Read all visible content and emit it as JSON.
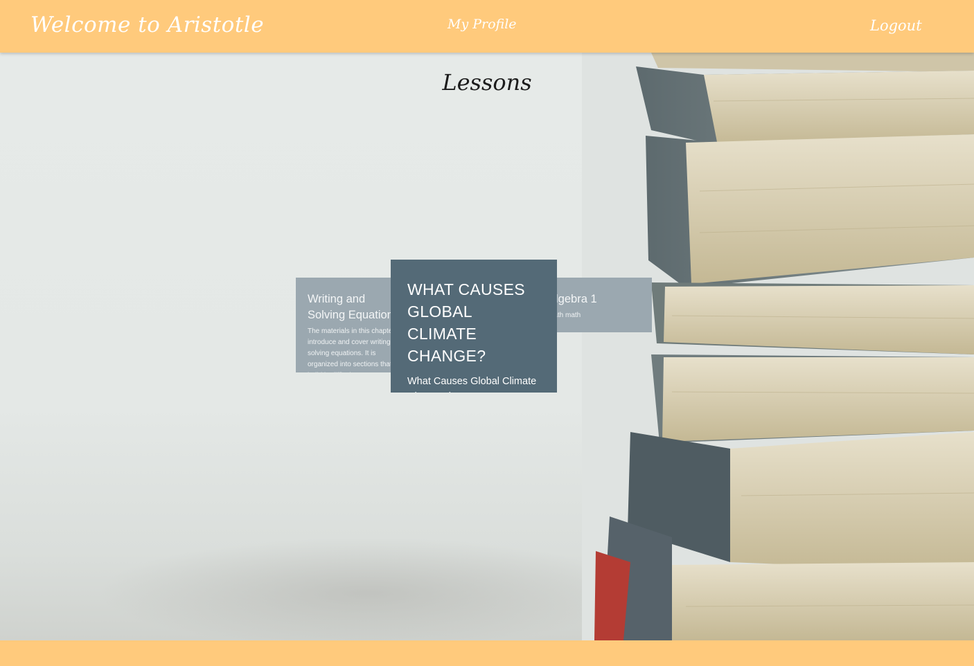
{
  "header": {
    "brand": "Welcome to Aristotle",
    "nav_profile": "My Profile",
    "nav_logout": "Logout"
  },
  "main": {
    "title": "Lessons",
    "cards": [
      {
        "title": "Writing and Solving Equations",
        "description": "The materials in this chapter introduce and cover writing and solving equations. It is organized into sections that build in difficulty"
      },
      {
        "title": "WHAT CAUSES GLOBAL CLIMATE CHANGE?",
        "description": "What Causes Global Climate Change demonstrates student attitudes towards"
      },
      {
        "title": "Algebra 1",
        "description": "Math math"
      }
    ]
  },
  "colors": {
    "header_bg": "#ffca7c",
    "card_active": "#546a77",
    "card_inactive": "#9ba8b0"
  }
}
